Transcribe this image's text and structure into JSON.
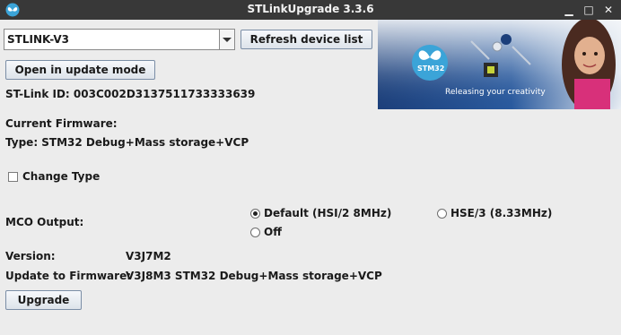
{
  "window": {
    "title": "STLinkUpgrade 3.3.6",
    "controls": [
      "minimize-icon",
      "maximize-icon",
      "close-icon"
    ]
  },
  "device": {
    "selected": "STLINK-V3",
    "refresh_label": "Refresh device list",
    "open_label": "Open in update mode",
    "stlink_id": "ST-Link ID: 003C002D3137511733333639"
  },
  "firmware": {
    "current_label": "Current Firmware:",
    "type": "Type: STM32 Debug+Mass storage+VCP",
    "change_type_label": "Change Type",
    "change_type_checked": false
  },
  "mco": {
    "label": "MCO Output:",
    "options": [
      {
        "label": "Default (HSI/2 8MHz)",
        "selected": true
      },
      {
        "label": "HSE/3 (8.33MHz)",
        "selected": false
      },
      {
        "label": "Off",
        "selected": false
      }
    ]
  },
  "version": {
    "label": "Version:",
    "value": "V3J7M2"
  },
  "update": {
    "label": "Update to Firmware:",
    "value": "V3J8M3 STM32 Debug+Mass storage+VCP",
    "upgrade_label": "Upgrade"
  },
  "banner": {
    "chip_text": "STM32",
    "tagline": "Releasing your creativity"
  },
  "colors": {
    "titlebar": "#383838",
    "background": "#ececec",
    "banner_blue": "#1f4a8a",
    "stm_blue": "#3ba4d8",
    "accent_pink": "#d8307a"
  }
}
